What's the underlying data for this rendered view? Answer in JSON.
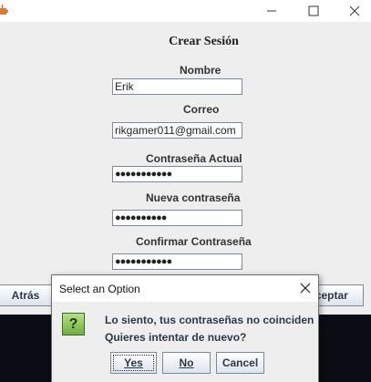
{
  "window": {
    "app_icon": "java-cup-icon",
    "controls": [
      "minimize-icon",
      "maximize-icon",
      "close-icon"
    ]
  },
  "form": {
    "title": "Crear Sesión",
    "nombre_label": "Nombre",
    "nombre_value": "Erik",
    "correo_label": "Correo",
    "correo_value": "rikgamer011@gmail.com",
    "actual_label": "Contraseña Actual",
    "actual_value": "●●●●●●●●●●●",
    "nueva_label": "Nueva contraseña",
    "nueva_value": "●●●●●●●●●●",
    "confirmar_label": "Confirmar Contraseña",
    "confirmar_value": "●●●●●●●●●●●",
    "atras_label": "Atrás",
    "aceptar_label": "Aceptar"
  },
  "dialog": {
    "title": "Select an Option",
    "icon": "question-icon",
    "icon_glyph": "?",
    "message_line1": "Lo siento, tus contraseñas no coinciden",
    "message_line2": "Quieres intentar de nuevo?",
    "yes_label": "Yes",
    "no_label": "No",
    "cancel_label": "Cancel"
  },
  "colors": {
    "accent_text": "#2b3a4a",
    "dark_background": "#0a0e14"
  }
}
